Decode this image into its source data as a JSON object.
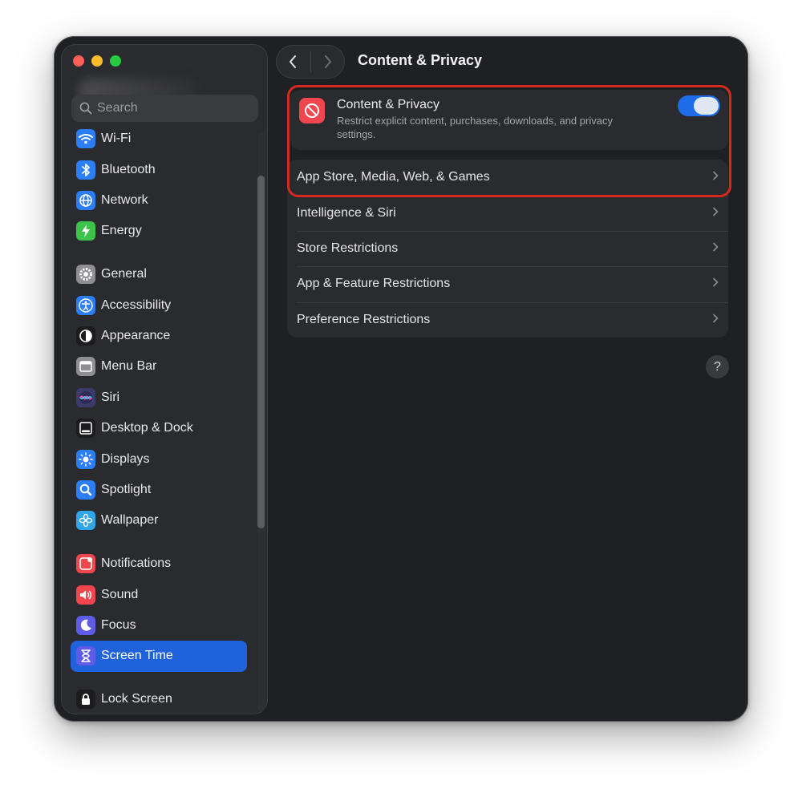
{
  "window": {
    "title": "Content & Privacy"
  },
  "sidebar": {
    "search_placeholder": "Search",
    "groups": [
      [
        {
          "label": "Wi-Fi",
          "icon": "wifi-icon",
          "color": "#2c7ef6"
        },
        {
          "label": "Bluetooth",
          "icon": "bluetooth-icon",
          "color": "#2c7ef6"
        },
        {
          "label": "Network",
          "icon": "globe-icon",
          "color": "#2c7ef6"
        },
        {
          "label": "Energy",
          "icon": "battery-icon",
          "color": "#3cc34a"
        }
      ],
      [
        {
          "label": "General",
          "icon": "gear-icon",
          "color": "#8e8e93"
        },
        {
          "label": "Accessibility",
          "icon": "accessibility-icon",
          "color": "#2c7ef6"
        },
        {
          "label": "Appearance",
          "icon": "appearance-icon",
          "color": "#1c1c1e"
        },
        {
          "label": "Menu Bar",
          "icon": "menubar-icon",
          "color": "#8e8e93"
        },
        {
          "label": "Siri",
          "icon": "siri-icon",
          "color": "#3b3b6e"
        },
        {
          "label": "Desktop & Dock",
          "icon": "dock-icon",
          "color": "#1c1c1e"
        },
        {
          "label": "Displays",
          "icon": "sun-icon",
          "color": "#2c7ef6"
        },
        {
          "label": "Spotlight",
          "icon": "magnifier-icon",
          "color": "#2c7ef6"
        },
        {
          "label": "Wallpaper",
          "icon": "flower-icon",
          "color": "#30a6e8"
        }
      ],
      [
        {
          "label": "Notifications",
          "icon": "bell-icon",
          "color": "#f0474f"
        },
        {
          "label": "Sound",
          "icon": "speaker-icon",
          "color": "#f0474f"
        },
        {
          "label": "Focus",
          "icon": "moon-icon",
          "color": "#5e5ce6"
        },
        {
          "label": "Screen Time",
          "icon": "hourglass-icon",
          "color": "#5e5ce6",
          "selected": true
        }
      ],
      [
        {
          "label": "Lock Screen",
          "icon": "lock-icon",
          "color": "#1c1c1e"
        }
      ]
    ]
  },
  "content_privacy": {
    "title": "Content & Privacy",
    "description": "Restrict explicit content, purchases, downloads, and privacy settings.",
    "enabled": true
  },
  "restrictions": [
    {
      "label": "App Store, Media, Web, & Games"
    },
    {
      "label": "Intelligence & Siri"
    },
    {
      "label": "Store Restrictions"
    },
    {
      "label": "App & Feature Restrictions"
    },
    {
      "label": "Preference Restrictions"
    }
  ],
  "help_label": "?",
  "colors": {
    "accent": "#1e6ce8",
    "selection": "#1f62d9",
    "highlight": "#d42a1e"
  }
}
